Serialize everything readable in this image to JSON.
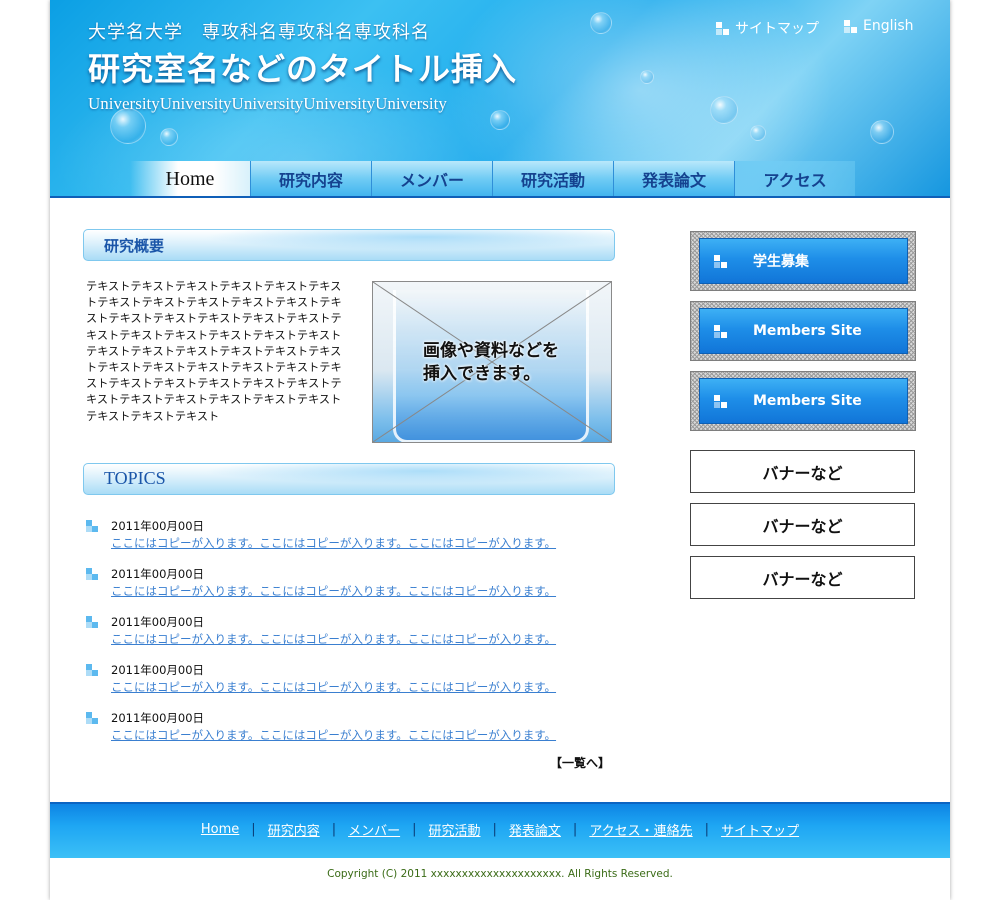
{
  "header": {
    "university_line": "大学名大学　専攻科名専攻科名専攻科名",
    "lab_title": "研究室名などのタイトル挿入",
    "university_en": "UniversityUniversityUniversityUniversityUniversity",
    "sitemap_link": "サイトマップ",
    "english_link": "English"
  },
  "nav": {
    "tabs": [
      {
        "label": "Home"
      },
      {
        "label": "研究内容"
      },
      {
        "label": "メンバー"
      },
      {
        "label": "研究活動"
      },
      {
        "label": "発表論文"
      },
      {
        "label": "アクセス"
      }
    ]
  },
  "overview": {
    "heading": "研究概要",
    "text": "テキストテキストテキストテキストテキストテキストテキストテキストテキストテキストテキストテキストテキストテキストテキストテキストテキストテキストテキストテキストテキストテキストテキストテキストテキストテキストテキストテキストテキストテキストテキストテキストテキストテキストテキストテキストテキストテキストテキストテキストテキストテキストテキストテキストテキストテキストテキストテキストテキスト",
    "image_caption_line1": "画像や資料などを",
    "image_caption_line2": "挿入できます。"
  },
  "topics": {
    "heading": "TOPICS",
    "items": [
      {
        "date": "2011年00月00日",
        "copy": "ここにはコピーが入ります。ここにはコピーが入ります。ここにはコピーが入ります。"
      },
      {
        "date": "2011年00月00日",
        "copy": "ここにはコピーが入ります。ここにはコピーが入ります。ここにはコピーが入ります。"
      },
      {
        "date": "2011年00月00日",
        "copy": "ここにはコピーが入ります。ここにはコピーが入ります。ここにはコピーが入ります。"
      },
      {
        "date": "2011年00月00日",
        "copy": "ここにはコピーが入ります。ここにはコピーが入ります。ここにはコピーが入ります。"
      },
      {
        "date": "2011年00月00日",
        "copy": "ここにはコピーが入ります。ここにはコピーが入ります。ここにはコピーが入ります。"
      }
    ],
    "more_link": "【一覧へ】"
  },
  "sidebar": {
    "buttons": [
      {
        "label": "学生募集"
      },
      {
        "label": "Members Site"
      },
      {
        "label": "Members Site"
      }
    ],
    "banners": [
      {
        "label": "バナーなど"
      },
      {
        "label": "バナーなど"
      },
      {
        "label": "バナーなど"
      }
    ]
  },
  "footer": {
    "links": [
      {
        "label": "Home"
      },
      {
        "label": "研究内容"
      },
      {
        "label": "メンバー"
      },
      {
        "label": "研究活動"
      },
      {
        "label": "発表論文"
      },
      {
        "label": "アクセス・連絡先"
      },
      {
        "label": "サイトマップ"
      }
    ],
    "separator": "|",
    "copyright": "Copyright (C) 2011 xxxxxxxxxxxxxxxxxxxxx. All Rights Reserved."
  },
  "colors": {
    "header_blue": "#1aa9ec",
    "nav_text": "#15428f",
    "topic_link": "#3a7fd0",
    "button_blue": "#1e8ee8",
    "copyright_green": "#3a6b16"
  },
  "icons": {
    "bullet": "checker-square-icon"
  }
}
